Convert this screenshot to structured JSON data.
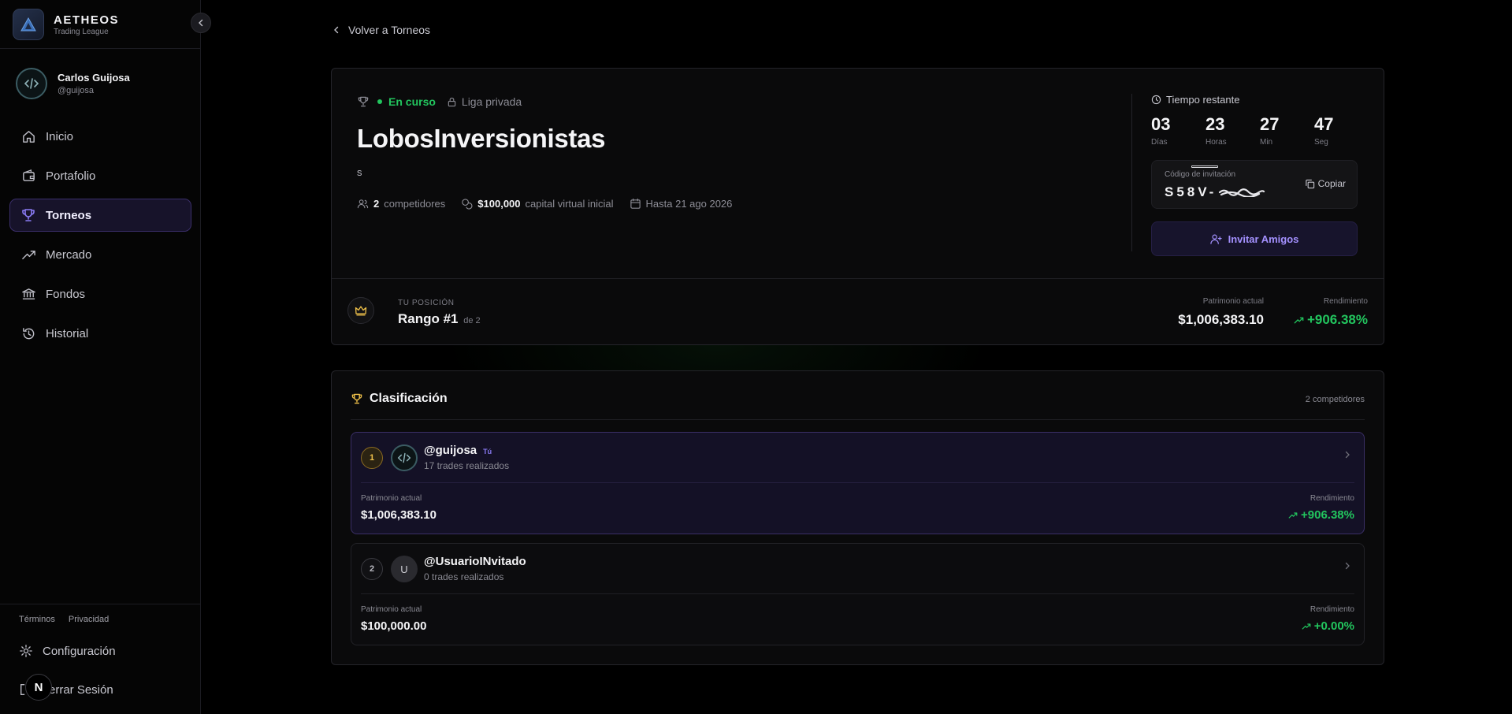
{
  "app": {
    "name": "AETHEOS",
    "subtitle": "Trading League"
  },
  "user": {
    "name": "Carlos Guijosa",
    "handle": "@guijosa"
  },
  "nav": [
    {
      "label": "Inicio",
      "icon": "home-icon"
    },
    {
      "label": "Portafolio",
      "icon": "wallet-icon"
    },
    {
      "label": "Torneos",
      "icon": "trophy-icon",
      "active": true
    },
    {
      "label": "Mercado",
      "icon": "trending-up-icon"
    },
    {
      "label": "Fondos",
      "icon": "bank-icon"
    },
    {
      "label": "Historial",
      "icon": "history-icon"
    }
  ],
  "footer": {
    "terms": "Términos",
    "privacy": "Privacidad",
    "settings": "Configuración",
    "logout": "errar Sesión",
    "badge": "N"
  },
  "back_link": "Volver a Torneos",
  "tournament": {
    "status": "En curso",
    "privacy": "Liga privada",
    "name": "LobosInversionistas",
    "description": "s",
    "competitors_count": "2",
    "competitors_label": "competidores",
    "capital_value": "$100,000",
    "capital_label": "capital virtual inicial",
    "end_date": "Hasta 21 ago 2026"
  },
  "timer": {
    "label": "Tiempo restante",
    "units": [
      {
        "value": "03",
        "label": "Días"
      },
      {
        "value": "23",
        "label": "Horas"
      },
      {
        "value": "27",
        "label": "Min"
      },
      {
        "value": "47",
        "label": "Seg"
      }
    ]
  },
  "invite": {
    "label": "Código de invitación",
    "code": "S58V-",
    "copy": "Copiar",
    "button": "Invitar Amigos"
  },
  "position": {
    "label": "TU POSICIÓN",
    "rank": "Rango #1",
    "of": "de 2",
    "equity_label": "Patrimonio actual",
    "equity": "$1,006,383.10",
    "return_label": "Rendimiento",
    "return": "+906.38%"
  },
  "ranking": {
    "title": "Clasificación",
    "count": "2 competidores",
    "entries": [
      {
        "rank": "1",
        "handle": "@guijosa",
        "you": "Tú",
        "trades": "17 trades realizados",
        "equity_label": "Patrimonio actual",
        "equity": "$1,006,383.10",
        "return_label": "Rendimiento",
        "return": "+906.38%"
      },
      {
        "rank": "2",
        "avatar": "U",
        "handle": "@UsuarioINvitado",
        "trades": "0 trades realizados",
        "equity_label": "Patrimonio actual",
        "equity": "$100,000.00",
        "return_label": "Rendimiento",
        "return": "+0.00%"
      }
    ]
  },
  "colors": {
    "accent": "#8b7cf6",
    "positive": "#22c55e",
    "gold": "#f0c14a"
  }
}
